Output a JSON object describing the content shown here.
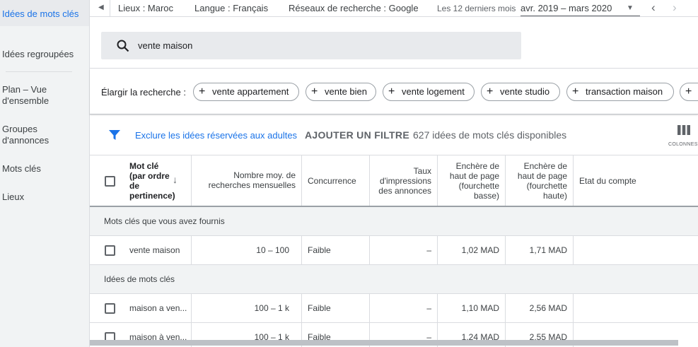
{
  "sidebar": {
    "items": [
      {
        "label": "Idées de mots clés",
        "active": true
      },
      {
        "label": "Idées regroupées"
      },
      {
        "label": "Plan – Vue d'ensemble"
      },
      {
        "label": "Groupes d'annonces"
      },
      {
        "label": "Mots clés"
      },
      {
        "label": "Lieux"
      }
    ]
  },
  "topbar": {
    "locations": "Lieux : Maroc",
    "language": "Langue : Français",
    "network": "Réseaux de recherche : Google",
    "period_label": "Les 12 derniers mois",
    "period_value": "avr. 2019 – mars 2020"
  },
  "search": {
    "value": "vente maison"
  },
  "broaden": {
    "label": "Élargir la recherche :",
    "chips": [
      "vente appartement",
      "vente bien",
      "vente logement",
      "vente studio",
      "transaction maison"
    ]
  },
  "filter": {
    "exclude_link": "Exclure les idées réservées aux adultes",
    "add_filter": "AJOUTER UN FILTRE",
    "count_text": "627 idées de mots clés disponibles",
    "columns_label": "COLONNES"
  },
  "table": {
    "headers": {
      "keyword": "Mot clé (par ordre de pertinence)",
      "searches": "Nombre moy. de recherches mensuelles",
      "competition": "Concurrence",
      "impressions": "Taux d'impressions des annonces",
      "bid_low": "Enchère de haut de page (fourchette basse)",
      "bid_high": "Enchère de haut de page (fourchette haute)",
      "account_status": "Etat du compte"
    },
    "sections": [
      {
        "title": "Mots clés que vous avez fournis",
        "rows": [
          {
            "keyword": "vente maison",
            "searches": "10 – 100",
            "competition": "Faible",
            "impressions": "–",
            "bid_low": "1,02 MAD",
            "bid_high": "1,71 MAD"
          }
        ]
      },
      {
        "title": "Idées de mots clés",
        "rows": [
          {
            "keyword": "maison a ven...",
            "searches": "100 – 1 k",
            "competition": "Faible",
            "impressions": "–",
            "bid_low": "1,10 MAD",
            "bid_high": "2,56 MAD"
          },
          {
            "keyword": "maison à ven...",
            "searches": "100 – 1 k",
            "competition": "Faible",
            "impressions": "–",
            "bid_low": "1,24 MAD",
            "bid_high": "2,55 MAD"
          }
        ]
      }
    ]
  },
  "colors": {
    "accent": "#1a73e8",
    "sidebar_bg": "#f1f3f4"
  }
}
